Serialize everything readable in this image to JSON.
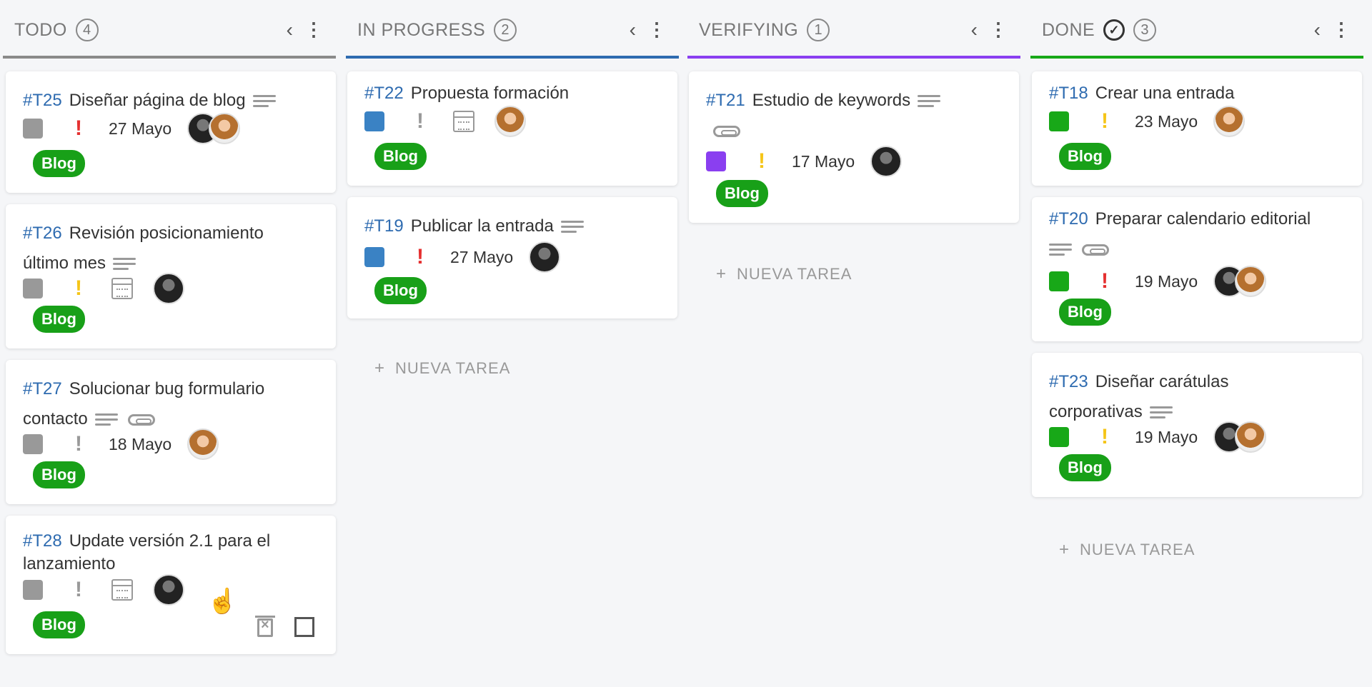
{
  "colors": {
    "todo_bar": "#8a8a8a",
    "in_progress_bar": "#2e6bb0",
    "verifying_bar": "#8a3ff0",
    "done_bar": "#18a818",
    "tag_green": "#18a018",
    "status_gray": "#999999",
    "status_blue": "#3a82c4",
    "status_purple": "#8a3ff0",
    "status_green": "#18a818",
    "priority_red": "#e53030",
    "priority_yellow": "#f5c518",
    "priority_gray": "#999999"
  },
  "columns": [
    {
      "title": "TODO",
      "count": "4"
    },
    {
      "title": "IN PROGRESS",
      "count": "2"
    },
    {
      "title": "VERIFYING",
      "count": "1"
    },
    {
      "title": "DONE",
      "count": "3",
      "done_icon": "check-circle-icon"
    }
  ],
  "cards": {
    "t25": {
      "id": "#T25",
      "title": "Diseñar página de blog",
      "date": "27 Mayo",
      "tag": "Blog",
      "priority": "!"
    },
    "t26": {
      "id": "#T26",
      "title": "Revisión posicionamiento",
      "title2": "último mes",
      "tag": "Blog",
      "priority": "!"
    },
    "t27": {
      "id": "#T27",
      "title": "Solucionar bug formulario",
      "title2": "contacto",
      "date": "18 Mayo",
      "tag": "Blog",
      "priority": "!"
    },
    "t28": {
      "id": "#T28",
      "title": "Update versión 2.1 para el",
      "title2": "lanzamiento",
      "tag": "Blog",
      "priority": "!"
    },
    "t22": {
      "id": "#T22",
      "title": "Propuesta formación",
      "tag": "Blog",
      "priority": "!"
    },
    "t19": {
      "id": "#T19",
      "title": "Publicar la entrada",
      "date": "27 Mayo",
      "tag": "Blog",
      "priority": "!"
    },
    "t21": {
      "id": "#T21",
      "title": "Estudio de keywords",
      "date": "17 Mayo",
      "tag": "Blog",
      "priority": "!"
    },
    "t18": {
      "id": "#T18",
      "title": "Crear una entrada",
      "date": "23 Mayo",
      "tag": "Blog",
      "priority": "!"
    },
    "t20": {
      "id": "#T20",
      "title": "Preparar calendario editorial",
      "date": "19 Mayo",
      "tag": "Blog",
      "priority": "!"
    },
    "t23": {
      "id": "#T23",
      "title": "Diseñar carátulas",
      "title2": "corporativas",
      "date": "19 Mayo",
      "tag": "Blog",
      "priority": "!"
    }
  },
  "new_task_label": "NUEVA TAREA",
  "icons": {
    "chevron": "‹",
    "more": "⋮",
    "plus": "+",
    "check": "✓",
    "cursor": "☝"
  }
}
